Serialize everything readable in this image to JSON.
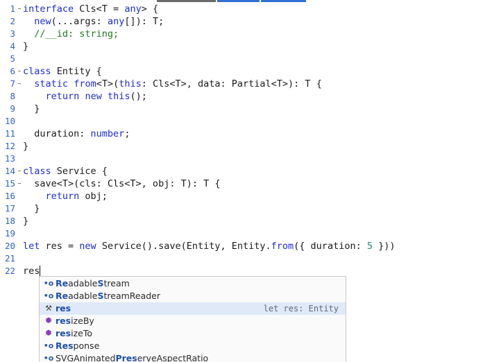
{
  "lines": [
    {
      "n": "1",
      "fold": "-",
      "code": "interface Cls<T = any> {"
    },
    {
      "n": "2",
      "fold": "",
      "code": "  new(...args: any[]): T;"
    },
    {
      "n": "3",
      "fold": "",
      "code": "  //__id: string;"
    },
    {
      "n": "4",
      "fold": "",
      "code": "}"
    },
    {
      "n": "5",
      "fold": "",
      "code": ""
    },
    {
      "n": "6",
      "fold": "-",
      "code": "class Entity {"
    },
    {
      "n": "7",
      "fold": "-",
      "code": "  static from<T>(this: Cls<T>, data: Partial<T>): T {"
    },
    {
      "n": "8",
      "fold": "",
      "code": "    return new this();"
    },
    {
      "n": "9",
      "fold": "",
      "code": "  }"
    },
    {
      "n": "10",
      "fold": "",
      "code": ""
    },
    {
      "n": "11",
      "fold": "",
      "code": "  duration: number;"
    },
    {
      "n": "12",
      "fold": "",
      "code": "}"
    },
    {
      "n": "13",
      "fold": "",
      "code": ""
    },
    {
      "n": "14",
      "fold": "-",
      "code": "class Service {"
    },
    {
      "n": "15",
      "fold": "-",
      "code": "  save<T>(cls: Cls<T>, obj: T): T {"
    },
    {
      "n": "16",
      "fold": "",
      "code": "    return obj;"
    },
    {
      "n": "17",
      "fold": "",
      "code": "  }"
    },
    {
      "n": "18",
      "fold": "",
      "code": "}"
    },
    {
      "n": "19",
      "fold": "",
      "code": ""
    },
    {
      "n": "20",
      "fold": "",
      "code": "let res = new Service().save(Entity, Entity.from({ duration: 5 }))"
    },
    {
      "n": "21",
      "fold": "",
      "code": ""
    },
    {
      "n": "22",
      "fold": "",
      "code": "res"
    }
  ],
  "suggestions": [
    {
      "icon": "property-icon",
      "match": "Re",
      "mid": "adable",
      "match2": "S",
      "rest": "tream",
      "detail": ""
    },
    {
      "icon": "property-icon",
      "match": "Re",
      "mid": "adable",
      "match2": "S",
      "rest": "treamReader",
      "detail": ""
    },
    {
      "icon": "variable-icon",
      "match": "res",
      "mid": "",
      "match2": "",
      "rest": "",
      "detail": "let res: Entity",
      "selected": true
    },
    {
      "icon": "method-icon",
      "match": "res",
      "mid": "",
      "match2": "",
      "rest": "izeBy",
      "detail": ""
    },
    {
      "icon": "method-icon",
      "match": "res",
      "mid": "",
      "match2": "",
      "rest": "izeTo",
      "detail": ""
    },
    {
      "icon": "property-icon",
      "match": "Res",
      "mid": "",
      "match2": "",
      "rest": "ponse",
      "detail": ""
    },
    {
      "icon": "property-icon",
      "match": "",
      "mid": "SVGAnimated",
      "match2": "Pres",
      "rest": "erveAspectRatio",
      "detail": ""
    }
  ],
  "colors": {
    "keyword": "#1e2bd1",
    "comment": "#1f7a1f",
    "number": "#1f8f7a",
    "line_number": "#2b63c6",
    "selected_suggestion": "#dfe9f8",
    "top_strip_dark": "#5a5a5a",
    "top_strip_blue": "#2f6fd6"
  }
}
